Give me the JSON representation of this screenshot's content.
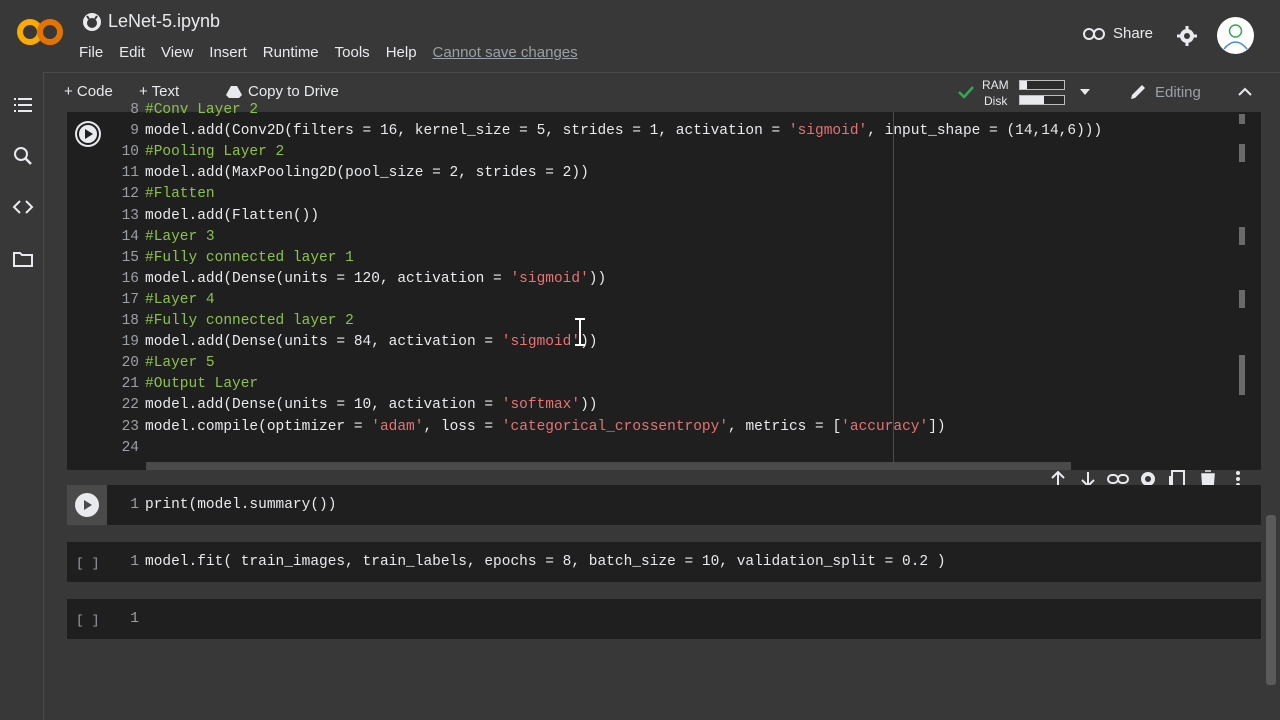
{
  "header": {
    "title": "LeNet-5.ipynb",
    "menu": [
      "File",
      "Edit",
      "View",
      "Insert",
      "Runtime",
      "Tools",
      "Help"
    ],
    "cannot_save": "Cannot save changes",
    "share_label": "Share"
  },
  "toolbar": {
    "code_label": "+ Code",
    "text_label": "+ Text",
    "copy_label": "Copy to Drive",
    "ram_label": "RAM",
    "disk_label": "Disk",
    "ram_fraction": 0.15,
    "disk_fraction": 0.55,
    "editing_label": "Editing"
  },
  "cells": [
    {
      "lines": [
        {
          "n": "8",
          "code": "#Conv Layer 2"
        },
        {
          "n": "9",
          "code": "model.add(Conv2D(filters = 16, kernel_size = 5, strides = 1, activation = 'sigmoid', input_shape = (14,14,6)))"
        },
        {
          "n": "10",
          "code": "#Pooling Layer 2"
        },
        {
          "n": "11",
          "code": "model.add(MaxPooling2D(pool_size = 2, strides = 2))"
        },
        {
          "n": "12",
          "code": "#Flatten"
        },
        {
          "n": "13",
          "code": "model.add(Flatten())"
        },
        {
          "n": "14",
          "code": "#Layer 3"
        },
        {
          "n": "15",
          "code": "#Fully connected layer 1"
        },
        {
          "n": "16",
          "code": "model.add(Dense(units = 120, activation = 'sigmoid'))"
        },
        {
          "n": "17",
          "code": "#Layer 4"
        },
        {
          "n": "18",
          "code": "#Fully connected layer 2"
        },
        {
          "n": "19",
          "code": "model.add(Dense(units = 84, activation = 'sigmoid'))"
        },
        {
          "n": "20",
          "code": "#Layer 5"
        },
        {
          "n": "21",
          "code": "#Output Layer"
        },
        {
          "n": "22",
          "code": "model.add(Dense(units = 10, activation = 'softmax'))"
        },
        {
          "n": "23",
          "code": "model.compile(optimizer = 'adam', loss = 'categorical_crossentropy', metrics = ['accuracy'])"
        },
        {
          "n": "24",
          "code": ""
        }
      ]
    },
    {
      "bracket": "",
      "lines": [
        {
          "n": "1",
          "code": "print(model.summary())"
        }
      ]
    },
    {
      "bracket": "[ ]",
      "lines": [
        {
          "n": "1",
          "code": "model.fit( train_images, train_labels, epochs = 8, batch_size = 10, validation_split = 0.2 )"
        }
      ]
    },
    {
      "bracket": "[ ]",
      "lines": [
        {
          "n": "1",
          "code": ""
        }
      ]
    }
  ],
  "colors": {
    "accent_orange": "#f9ab00",
    "check_green": "#34a853",
    "comment_green": "#8bc34a",
    "string_red": "#e57373"
  }
}
